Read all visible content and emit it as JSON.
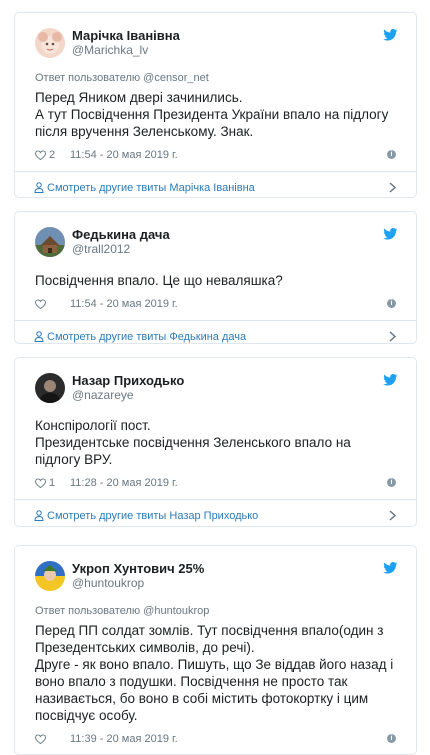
{
  "tweets": [
    {
      "name": "Марічка Іванівна",
      "handle": "@Marichka_lv",
      "reply_to": "Ответ пользователю @censor_net",
      "lines": [
        "Перед Яником двері зачинились.",
        "А тут Посвідчення Президента України впало на підлогу після вручення Зеленському.  Знак."
      ],
      "likes": "2",
      "time": "11:54 - 20 мая 2019 г.",
      "more_label": "Смотреть другие твиты Марічка Іванівна"
    },
    {
      "name": "Федькина дача",
      "handle": "@trall2012",
      "reply_to": "",
      "lines": [
        "Посвідчення впало. Це що неваляшка?"
      ],
      "likes": "",
      "time": "11:54 - 20 мая 2019 г.",
      "more_label": "Смотреть другие твиты Федькина дача"
    },
    {
      "name": "Назар Приходько",
      "handle": "@nazareye",
      "reply_to": "",
      "lines": [
        "Конспірології пост.",
        "Президентське посвідчення Зеленського впало на підлогу ВРУ."
      ],
      "likes": "1",
      "time": "11:28 - 20 мая 2019 г.",
      "more_label": "Смотреть другие твиты Назар Приходько"
    },
    {
      "name": "Укроп Хунтович 25%",
      "handle": "@huntoukrop",
      "reply_to": "Ответ пользователю @huntoukrop",
      "lines": [
        "Перед ПП солдат зомлів. Тут посвідчення впало(один з Презедентських символів, до речі).",
        "Друге - як воно впало. Пишуть, що Зе віддав його назад і воно впало з подушки. Посвідчення не просто так називається, бо воно в собі містить фотокортку і цим посвідчує особу."
      ],
      "likes": "",
      "time": "11:39 - 20 мая 2019 г.",
      "more_label": ""
    }
  ],
  "colors": {
    "link": "#2b7bb9",
    "muted": "#697882",
    "border": "#e1e8ed",
    "twitter_blue": "#1da1f2"
  },
  "icons": {
    "brand": "twitter-bird-icon",
    "like": "heart-icon",
    "info": "info-icon",
    "profile": "person-icon",
    "next": "chevron-right-icon"
  },
  "info_glyph": "i"
}
